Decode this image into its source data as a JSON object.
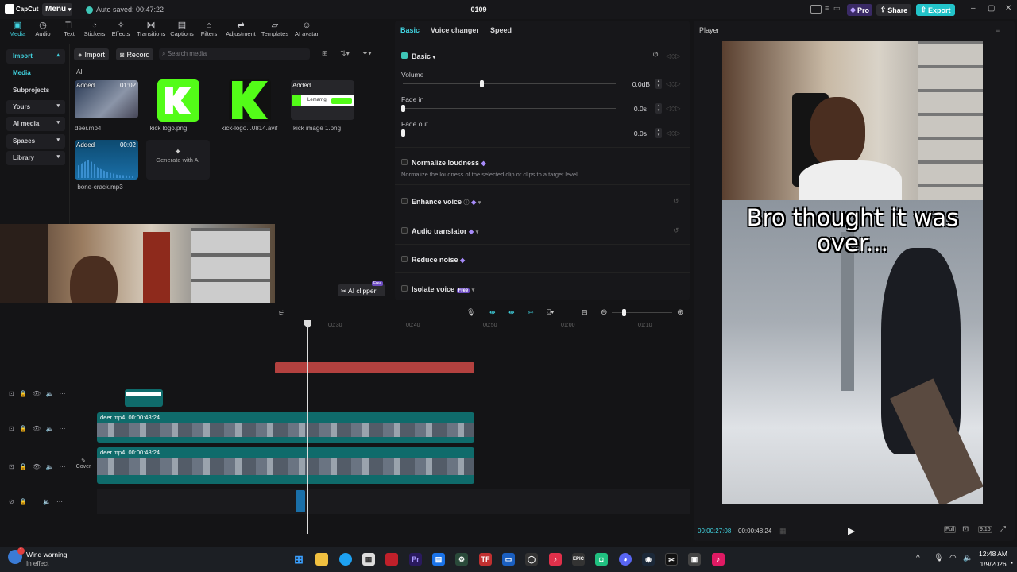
{
  "topbar": {
    "logo": "CapCut",
    "menu": "Menu",
    "autosave": "Auto saved: 00:47:22",
    "project_title": "0109",
    "pro": "Pro",
    "share": "Share",
    "export": "Export"
  },
  "toolbar": {
    "items": [
      "Media",
      "Audio",
      "Text",
      "Stickers",
      "Effects",
      "Transitions",
      "Captions",
      "Filters",
      "Adjustment",
      "Templates",
      "AI avatar"
    ]
  },
  "sidebar": {
    "items": [
      "Import",
      "Media",
      "Subprojects",
      "Yours",
      "AI media",
      "Spaces",
      "Library"
    ]
  },
  "media": {
    "import": "Import",
    "record": "Record",
    "search_placeholder": "Search media",
    "filter_all": "All",
    "added": "Added",
    "items": [
      {
        "name": "deer.mp4",
        "duration": "01:02"
      },
      {
        "name": "kick logo.png"
      },
      {
        "name": "kick-logo...0814.avif"
      },
      {
        "name": "kick image 1.png"
      },
      {
        "name": "bone-crack.mp3",
        "duration": "00:02"
      }
    ],
    "generate": "Generate with AI",
    "kick_banner": "Lemarngl"
  },
  "props": {
    "tabs": [
      "Basic",
      "Voice changer",
      "Speed"
    ],
    "basic_header": "Basic",
    "volume_label": "Volume",
    "volume_value": "0.0dB",
    "fadein_label": "Fade in",
    "fadein_value": "0.0s",
    "fadeout_label": "Fade out",
    "fadeout_value": "0.0s",
    "normalize": "Normalize loudness",
    "normalize_desc": "Normalize the loudness of the selected clip or clips to a target level.",
    "enhance": "Enhance voice",
    "translator": "Audio translator",
    "reduce_noise": "Reduce noise",
    "isolate": "Isolate voice",
    "free_badge": "Free",
    "volume_level": 0.5
  },
  "ai_clipper": {
    "label": "AI clipper",
    "badge": "Free"
  },
  "player": {
    "title": "Player",
    "caption": "Bro thought it was over...",
    "current_time": "00:00:27:08",
    "total_time": "00:00:48:24",
    "full": "Full",
    "ratio": "9:16"
  },
  "timeline": {
    "ticks": [
      "00:30",
      "00:40",
      "00:50",
      "01:00",
      "01:10"
    ],
    "clip1_name": "deer.mp4",
    "clip1_dur": "00:00:48:24",
    "clip2_name": "deer.mp4",
    "clip2_dur": "00:00:48:24",
    "cover": "Cover"
  },
  "taskbar": {
    "weather_title": "Wind warning",
    "weather_sub": "In effect",
    "weather_count": "1",
    "time": "12:48 AM",
    "date": "1/9/2026"
  },
  "colors": {
    "accent": "#41d3e0",
    "export": "#22c3c9",
    "pro": "#6d4cc2",
    "clip": "#0f6b6b",
    "red_bar": "#b3413f"
  }
}
